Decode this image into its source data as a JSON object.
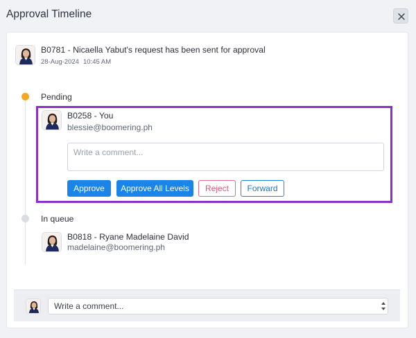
{
  "header": {
    "title": "Approval Timeline",
    "close_icon": "close-icon"
  },
  "request": {
    "text": "B0781 - Nicaella Yabut's request has been sent for approval",
    "date": "28-Aug-2024",
    "time": "10:45 AM"
  },
  "pending": {
    "label": "Pending",
    "dot_color": "#f5a623",
    "approver": {
      "name": "B0258 - You",
      "email": "blessie@boomering.ph"
    },
    "comment_placeholder": "Write a comment...",
    "buttons": {
      "approve": "Approve",
      "approve_all": "Approve All Levels",
      "reject": "Reject",
      "forward": "Forward"
    },
    "highlight_color": "#8b2fc9"
  },
  "queue": {
    "label": "In queue",
    "dot_color": "#d9dce1",
    "approver": {
      "name": "B0818 - Ryane Madelaine David",
      "email": "madelaine@boomering.ph"
    }
  },
  "footer": {
    "comment_placeholder": "Write a comment..."
  },
  "colors": {
    "primary": "#1a84e8",
    "reject": "#e0557a"
  }
}
